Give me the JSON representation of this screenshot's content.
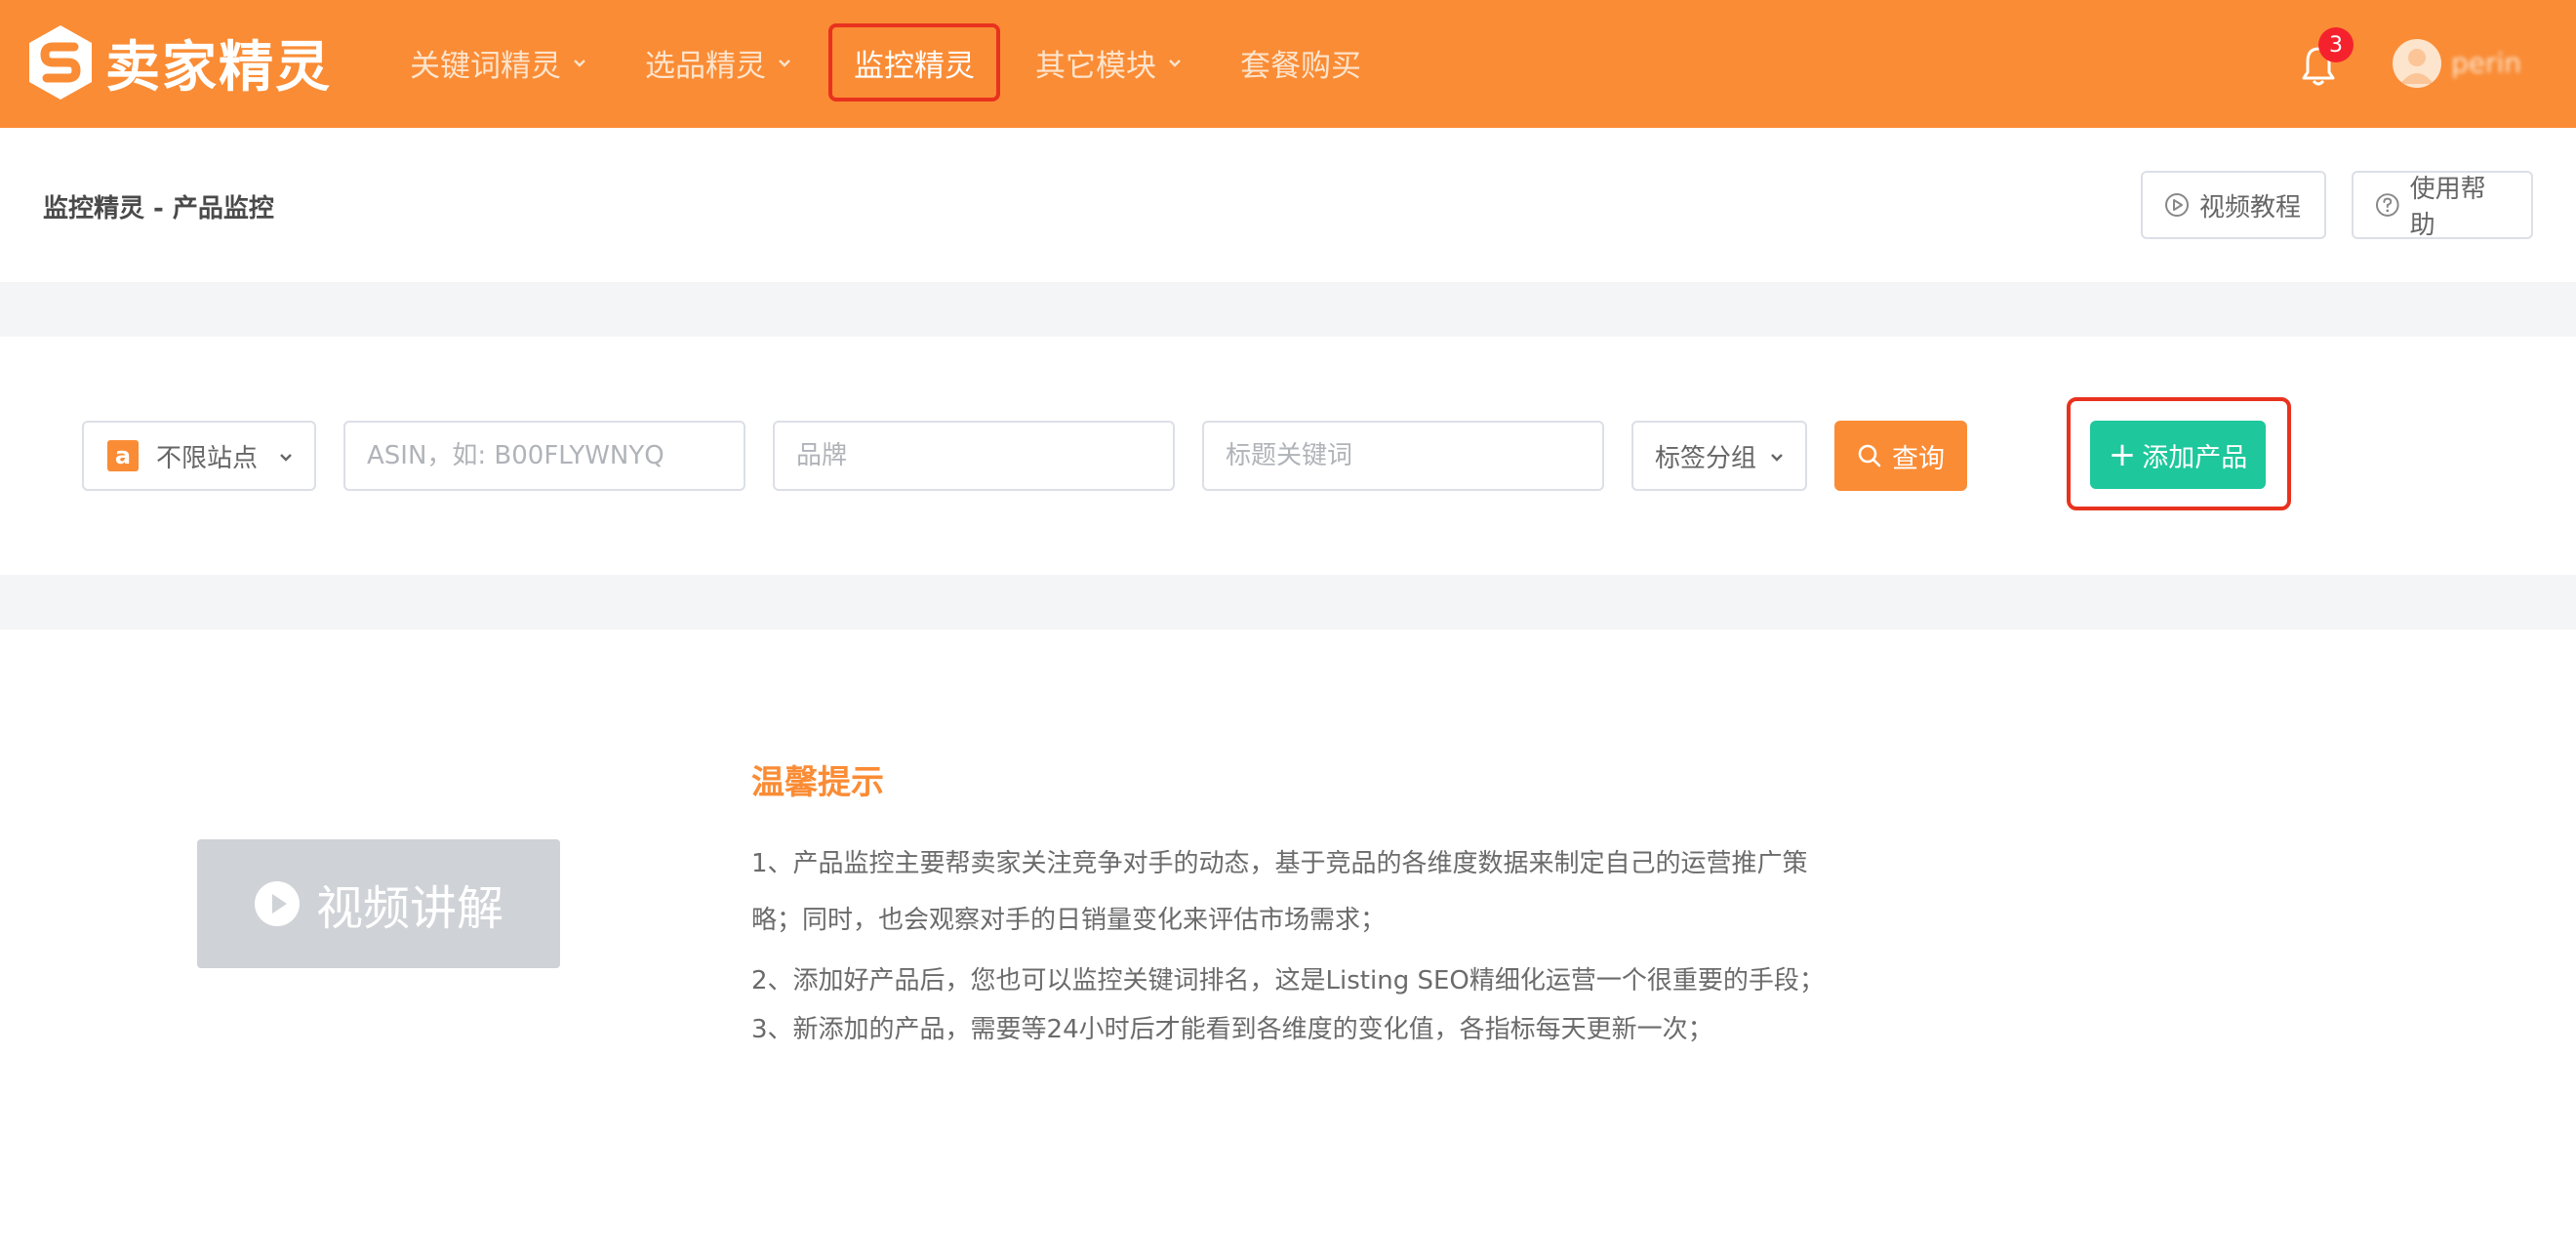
{
  "header": {
    "brand_name": "卖家精灵",
    "nav": [
      {
        "label": "关键词精灵",
        "has_dropdown": true
      },
      {
        "label": "选品精灵",
        "has_dropdown": true
      },
      {
        "label": "监控精灵",
        "active": true
      },
      {
        "label": "其它模块",
        "has_dropdown": true
      },
      {
        "label": "套餐购买"
      }
    ],
    "notification_count": "3",
    "username": "perin",
    "accent_color": "#fa8c35"
  },
  "page": {
    "breadcrumb": "监控精灵 - 产品监控",
    "video_tutorial_label": "视频教程",
    "help_label": "使用帮助"
  },
  "filters": {
    "site_select": "不限站点",
    "site_icon": "a",
    "asin_placeholder": "ASIN，如: B00FLYWNYQ",
    "brand_placeholder": "品牌",
    "title_keyword_placeholder": "标题关键词",
    "tag_group_select": "标签分组",
    "query_label": "查询",
    "add_product_label": "添加产品",
    "add_product_color": "#1ec79c"
  },
  "tips": {
    "video_label": "视频讲解",
    "title": "温馨提示",
    "lines": [
      "1、产品监控主要帮卖家关注竞争对手的动态，基于竞品的各维度数据来制定自己的运营推广策",
      "略；同时，也会观察对手的日销量变化来评估市场需求；",
      "2、添加好产品后，您也可以监控关键词排名，这是Listing SEO精细化运营一个很重要的手段；",
      "3、新添加的产品，需要等24小时后才能看到各维度的变化值，各指标每天更新一次；"
    ]
  }
}
